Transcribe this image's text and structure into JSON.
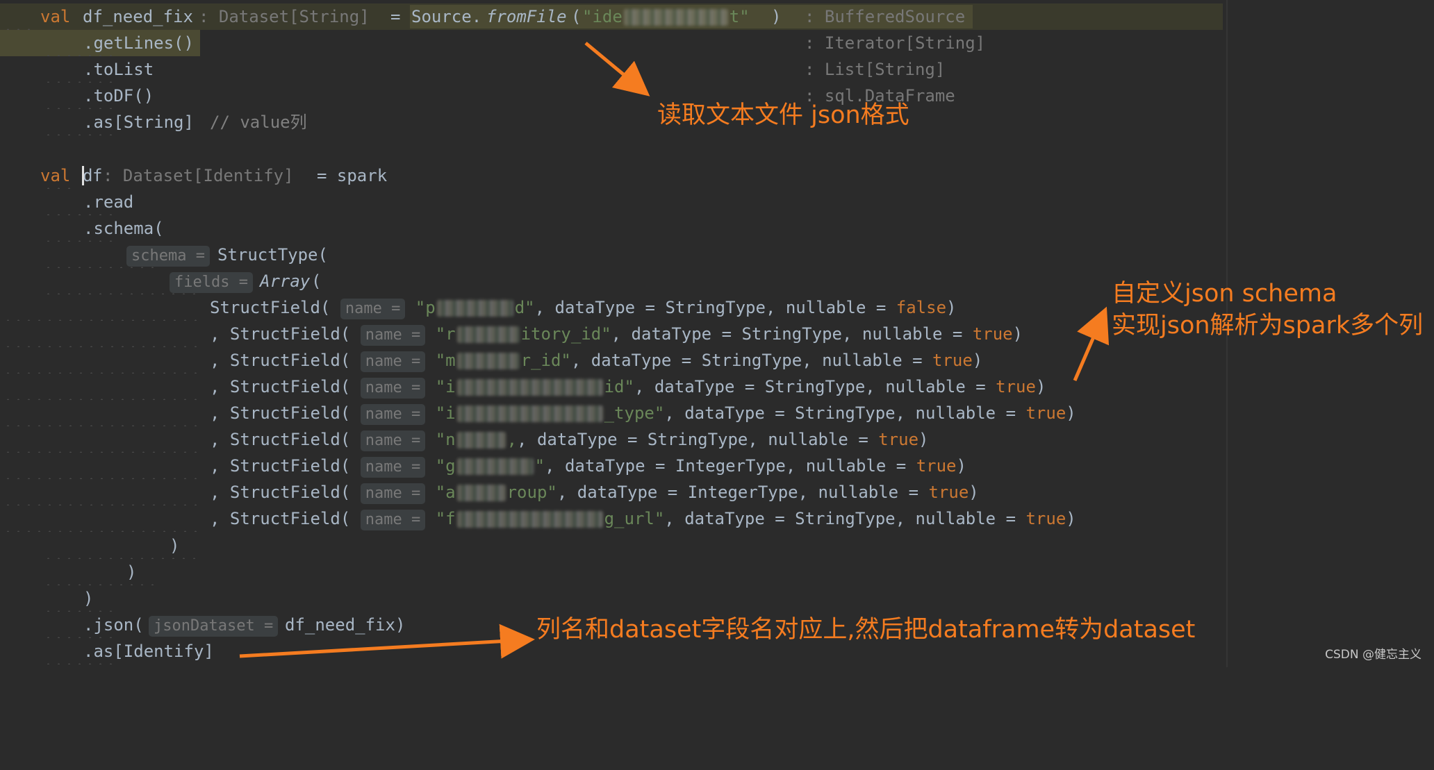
{
  "code": {
    "l1_kw": "val",
    "l1_name": "df_need_fix",
    "l1_hint": ": Dataset[String]",
    "l1_eq": "=",
    "l1_source": "Source.",
    "l1_fromfile": "fromFile",
    "l1_paren_open": "(",
    "l1_str_a": "\"ide",
    "l1_str_b": "t\"",
    "l1_paren_close": ")",
    "l1_type": ": BufferedSource",
    "l2_code": ".getLines()",
    "l2_type": ": Iterator[String]",
    "l3_code": ".toList",
    "l3_type": ": List[String]",
    "l4_code": ".toDF()",
    "l4_type": ": sql.DataFrame",
    "l5_code": ".as[String]",
    "l5_comment": "// value列",
    "l7_kw": "val",
    "l7_d": "d",
    "l7_f": "f",
    "l7_hint": ": Dataset[Identify]",
    "l7_rest": "= spark",
    "l8_code": ".read",
    "l9_code": ".schema(",
    "l10_hint": "schema =",
    "l10_code": "StructType(",
    "l11_hint": "fields =",
    "l11_array": "Array",
    "l11_paren": "(",
    "field_prefix_first": "StructField(",
    "field_prefix": ", StructField(",
    "name_hint": "name =",
    "dt_label": ", dataType =",
    "nullable_label": ", nullable =",
    "close_paren": ")",
    "fields": [
      {
        "str_a": "\"p",
        "str_b": "d\"",
        "type": "StringType",
        "nullable": "false"
      },
      {
        "str_a": "\"r",
        "str_b": "itory_id\"",
        "type": "StringType",
        "nullable": "true"
      },
      {
        "str_a": "\"m",
        "str_b": "r_id\"",
        "type": "StringType",
        "nullable": "true"
      },
      {
        "str_a": "\"i",
        "str_b": "id\"",
        "type": "StringType",
        "nullable": "true"
      },
      {
        "str_a": "\"i",
        "str_b": "_type\"",
        "type": "StringType",
        "nullable": "true"
      },
      {
        "str_a": "\"n",
        "str_b": ",",
        "type": "StringType",
        "nullable": "true"
      },
      {
        "str_a": "\"g",
        "str_b": "\"",
        "type": "IntegerType",
        "nullable": "true"
      },
      {
        "str_a": "\"a",
        "str_b": "roup\"",
        "type": "IntegerType",
        "nullable": "true"
      },
      {
        "str_a": "\"f",
        "str_b": "g_url\"",
        "type": "StringType",
        "nullable": "true"
      }
    ],
    "l21_code": ")",
    "l22_code": ")",
    "l23_code": ")",
    "l24_code": ".json(",
    "l24_hint": "jsonDataset =",
    "l24_rest": "df_need_fix)",
    "l25_code": ".as[Identify]"
  },
  "annotations": {
    "read_text": "读取文本文件 json格式",
    "schema_line1": "自定义json schema",
    "schema_line2": "实现json解析为spark多个列",
    "dataset_text": "列名和dataset字段名对应上,然后把dataframe转为dataset"
  },
  "watermark": "CSDN @健忘主义",
  "colors": {
    "background": "#2b2b2b",
    "keyword": "#cc7832",
    "string": "#6a8759",
    "code": "#a9b7c6",
    "hint": "#787878",
    "annotation": "#f57c20"
  }
}
